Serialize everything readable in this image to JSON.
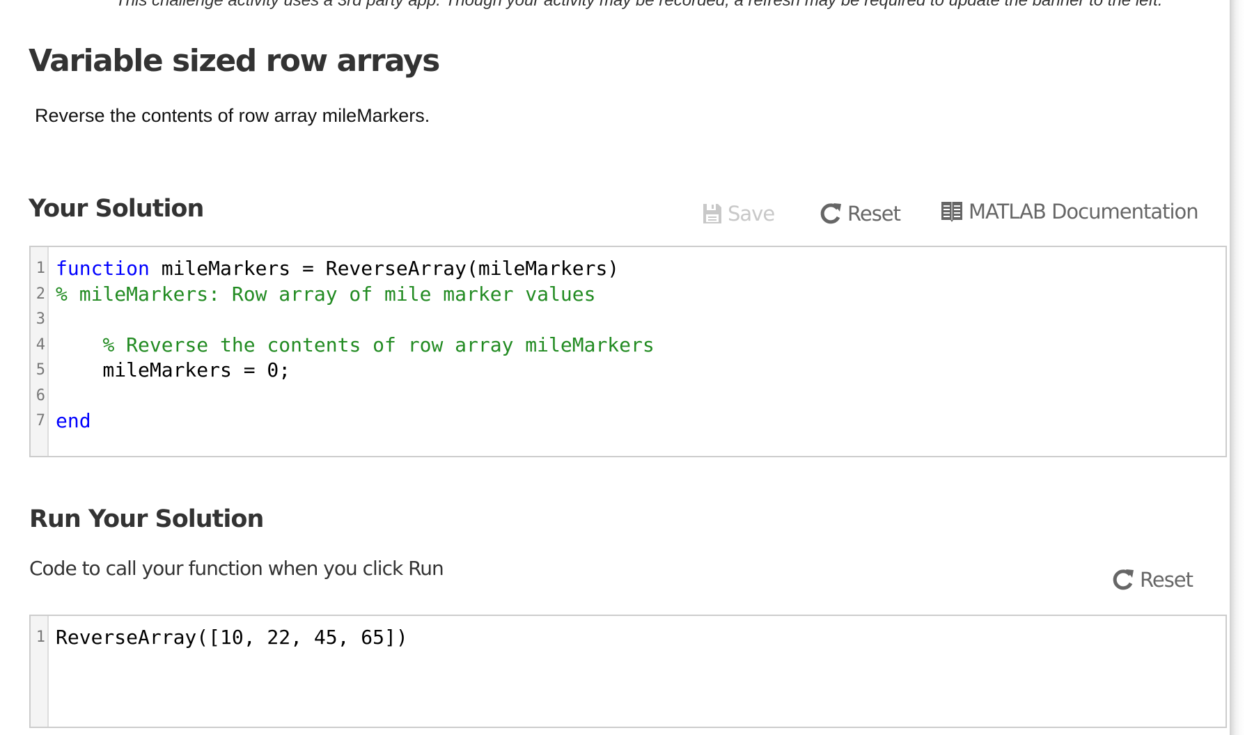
{
  "banner": {
    "text": "This challenge activity uses a 3rd party app. Though your activity may be recorded, a refresh may be required to update the banner to the left."
  },
  "activity": {
    "title": "Variable sized row arrays",
    "instructions": "Reverse the contents of row array mileMarkers."
  },
  "solution": {
    "heading": "Your Solution",
    "toolbar": {
      "save_label": "Save",
      "save_icon": "floppy-disk-icon",
      "save_enabled": false,
      "reset_label": "Reset",
      "reset_icon": "refresh-icon",
      "docs_label": "MATLAB Documentation",
      "docs_icon": "book-icon"
    },
    "editor": {
      "lines": [
        {
          "number": "1",
          "tokens": [
            {
              "type": "keyword",
              "text": "function"
            },
            {
              "type": "plain",
              "text": " mileMarkers = ReverseArray(mileMarkers)"
            }
          ]
        },
        {
          "number": "2",
          "tokens": [
            {
              "type": "comment",
              "text": "% mileMarkers: Row array of mile marker values"
            }
          ]
        },
        {
          "number": "3",
          "tokens": []
        },
        {
          "number": "4",
          "tokens": [
            {
              "type": "plain",
              "text": "    "
            },
            {
              "type": "comment",
              "text": "% Reverse the contents of row array mileMarkers"
            }
          ]
        },
        {
          "number": "5",
          "tokens": [
            {
              "type": "plain",
              "text": "    mileMarkers = 0;"
            }
          ]
        },
        {
          "number": "6",
          "tokens": []
        },
        {
          "number": "7",
          "tokens": [
            {
              "type": "keyword",
              "text": "end"
            }
          ]
        }
      ]
    }
  },
  "run": {
    "heading": "Run Your Solution",
    "description": "Code to call your function when you click Run",
    "reset_label": "Reset",
    "reset_icon": "refresh-icon",
    "editor": {
      "lines": [
        {
          "number": "1",
          "tokens": [
            {
              "type": "plain",
              "text": "ReverseArray([10, 22, 45, 65])"
            }
          ]
        }
      ]
    }
  },
  "colors": {
    "keyword": "#0000ff",
    "comment": "#228b22",
    "text": "#333333",
    "button": "#666666",
    "disabled": "#c8c8c8",
    "editor_border": "#cccccc"
  }
}
